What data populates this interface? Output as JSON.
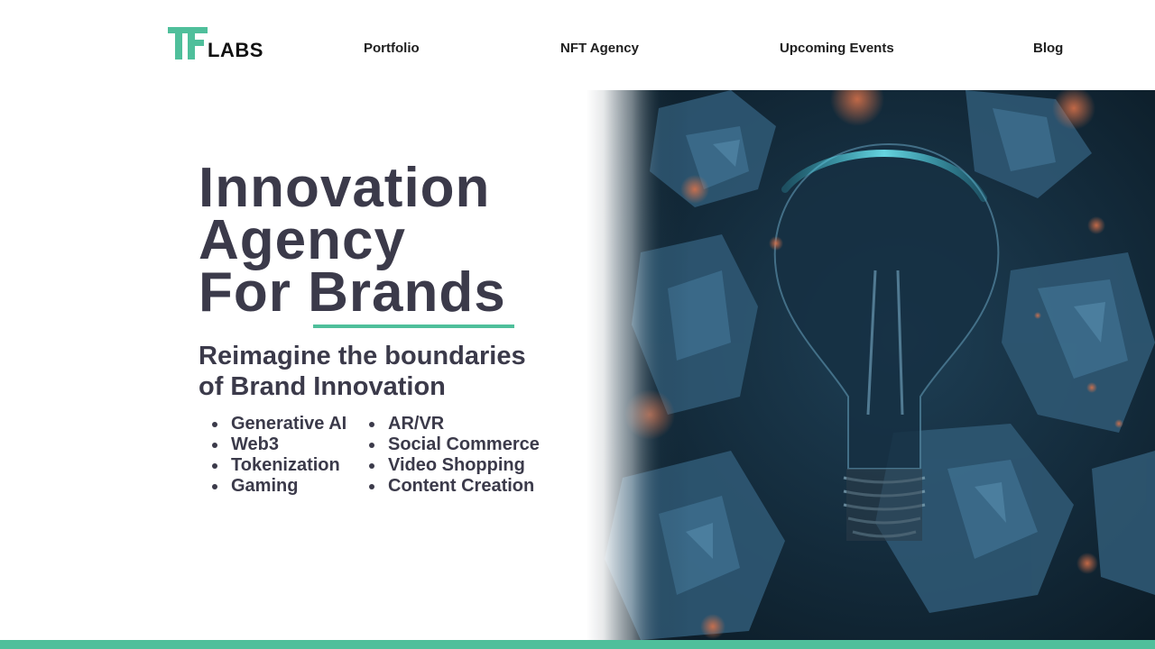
{
  "brand": {
    "logo_text": "LABS",
    "logo_mark": "tf-logo-icon",
    "accent_color": "#4fbf9b",
    "text_color": "#3b3a4a"
  },
  "nav": {
    "items": [
      {
        "label": "Portfolio"
      },
      {
        "label": "NFT Agency"
      },
      {
        "label": "Upcoming Events"
      },
      {
        "label": "Blog"
      }
    ]
  },
  "hero": {
    "headline": [
      "Innovation",
      "Agency",
      "For Brands"
    ],
    "subheadline": [
      "Reimagine the boundaries",
      "of Brand Innovation"
    ],
    "services_left": [
      "Generative AI",
      "Web3",
      "Tokenization",
      "Gaming"
    ],
    "services_right": [
      "AR/VR",
      "Social Commerce",
      "Video Shopping",
      "Content Creation"
    ],
    "image": "lightbulb-crumpled-paper-image"
  }
}
